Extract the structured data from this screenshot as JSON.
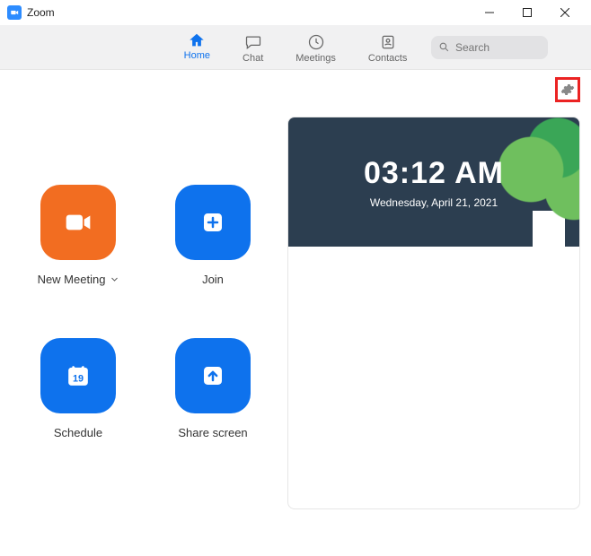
{
  "window": {
    "title": "Zoom"
  },
  "nav": {
    "home": "Home",
    "chat": "Chat",
    "meetings": "Meetings",
    "contacts": "Contacts"
  },
  "search": {
    "placeholder": "Search"
  },
  "actions": {
    "new_meeting": "New Meeting",
    "join": "Join",
    "schedule": "Schedule",
    "share": "Share screen",
    "calendar_day": "19"
  },
  "clock": {
    "time": "03:12 AM",
    "date": "Wednesday, April 21, 2021"
  }
}
